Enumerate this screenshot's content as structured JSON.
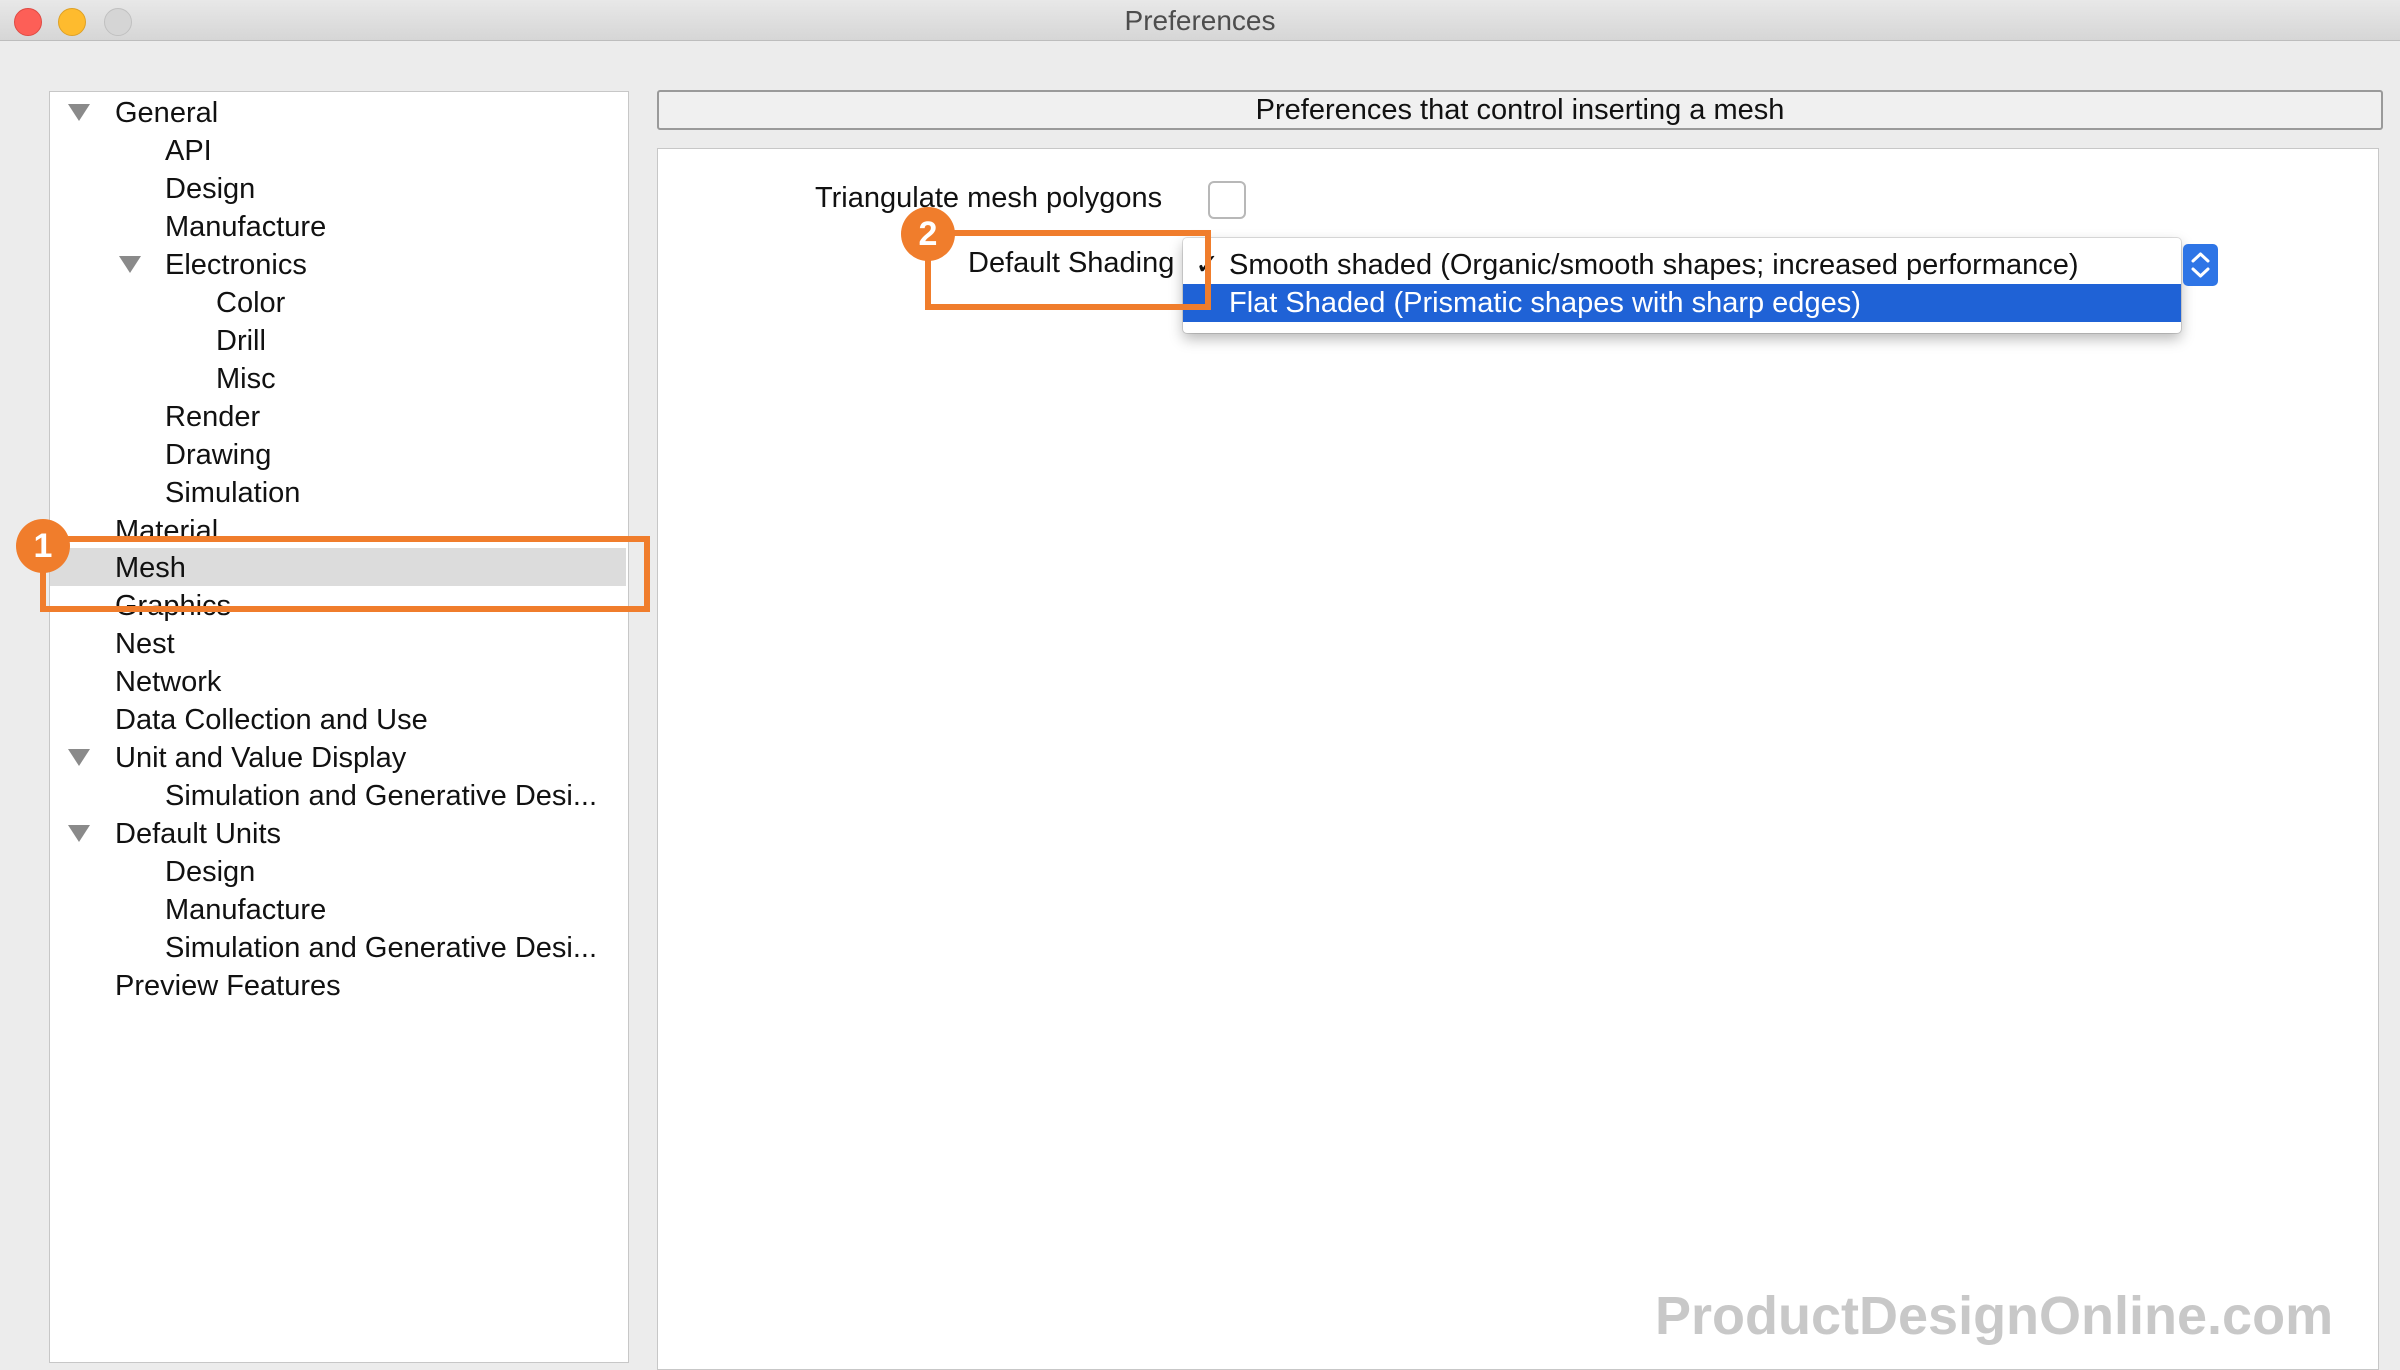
{
  "window": {
    "title": "Preferences"
  },
  "sidebar": {
    "items": [
      {
        "label": "General"
      },
      {
        "label": "API"
      },
      {
        "label": "Design"
      },
      {
        "label": "Manufacture"
      },
      {
        "label": "Electronics"
      },
      {
        "label": "Color"
      },
      {
        "label": "Drill"
      },
      {
        "label": "Misc"
      },
      {
        "label": "Render"
      },
      {
        "label": "Drawing"
      },
      {
        "label": "Simulation"
      },
      {
        "label": "Material"
      },
      {
        "label": "Mesh"
      },
      {
        "label": "Graphics"
      },
      {
        "label": "Nest"
      },
      {
        "label": "Network"
      },
      {
        "label": "Data Collection and Use"
      },
      {
        "label": "Unit and Value Display"
      },
      {
        "label": "Simulation and Generative Desi..."
      },
      {
        "label": "Default Units"
      },
      {
        "label": "Design"
      },
      {
        "label": "Manufacture"
      },
      {
        "label": "Simulation and Generative Desi..."
      },
      {
        "label": "Preview Features"
      }
    ],
    "selected": "Mesh"
  },
  "panel": {
    "header": "Preferences that control inserting a mesh",
    "triangulate_label": "Triangulate mesh polygons",
    "triangulate_checked": false,
    "default_shading_label": "Default Shading",
    "dropdown": {
      "options": [
        {
          "label": "Smooth shaded (Organic/smooth shapes; increased performance)",
          "checked": true,
          "check_glyph": "✓"
        },
        {
          "label": "Flat Shaded (Prismatic shapes with sharp edges)",
          "checked": false
        }
      ],
      "highlighted": "Flat Shaded (Prismatic shapes with sharp edges)"
    }
  },
  "callouts": [
    {
      "number": "1"
    },
    {
      "number": "2"
    }
  ],
  "watermark": "ProductDesignOnline.com",
  "colors": {
    "callout": "#f07d2c",
    "highlight": "#1f62d6",
    "selected_row": "#dcdcdc"
  }
}
